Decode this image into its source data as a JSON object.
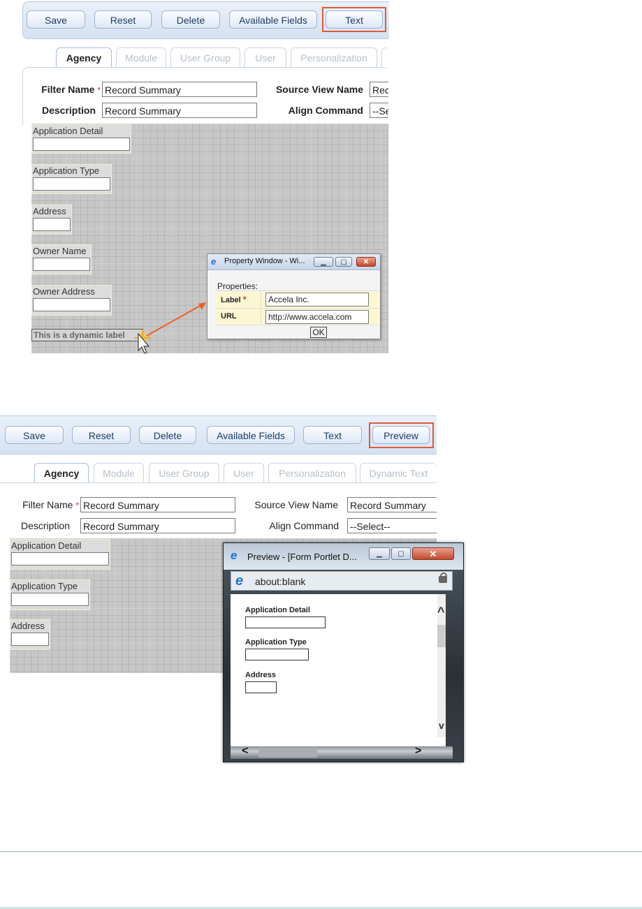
{
  "top": {
    "toolbar": {
      "save": "Save",
      "reset": "Reset",
      "delete": "Delete",
      "available_fields": "Available Fields",
      "text": "Text"
    },
    "tabs": [
      "Agency",
      "Module",
      "User Group",
      "User",
      "Personalization"
    ],
    "filter_name_label": "Filter Name",
    "filter_name_value": "Record Summary",
    "description_label": "Description",
    "description_value": "Record Summary",
    "source_view_label": "Source View Name",
    "source_view_value": "Rec",
    "align_label": "Align Command",
    "align_value": "--Se",
    "fields": [
      "Application Detail",
      "Application Type",
      "Address",
      "Owner Name",
      "Owner Address"
    ],
    "dynamic_label": "This is a dynamic label",
    "property_window": {
      "title": "Property Window - Wi...",
      "heading": "Properties:",
      "label_label": "Label",
      "label_value": "Accela Inc.",
      "url_label": "URL",
      "url_value": "http://www.accela.com",
      "ok": "OK"
    }
  },
  "bottom": {
    "toolbar": {
      "save": "Save",
      "reset": "Reset",
      "delete": "Delete",
      "available_fields": "Available Fields",
      "text": "Text",
      "preview": "Preview"
    },
    "tabs": [
      "Agency",
      "Module",
      "User Group",
      "User",
      "Personalization",
      "Dynamic Text"
    ],
    "filter_name_label": "Filter Name",
    "filter_name_value": "Record Summary",
    "description_label": "Description",
    "description_value": "Record Summary",
    "source_view_label": "Source View Name",
    "source_view_value": "Record Summary",
    "align_label": "Align Command",
    "align_value": "--Select--",
    "fields": [
      "Application Detail",
      "Application Type",
      "Address"
    ],
    "preview_window": {
      "title": "Preview - [Form Portlet D...",
      "address": "about:blank",
      "fields": [
        "Application Detail",
        "Application Type",
        "Address"
      ]
    }
  },
  "colors": {
    "highlight": "#e0583a",
    "arrow": "#e8641e",
    "grid": "#c7c7c7",
    "toolbar": "#dde8f6"
  }
}
